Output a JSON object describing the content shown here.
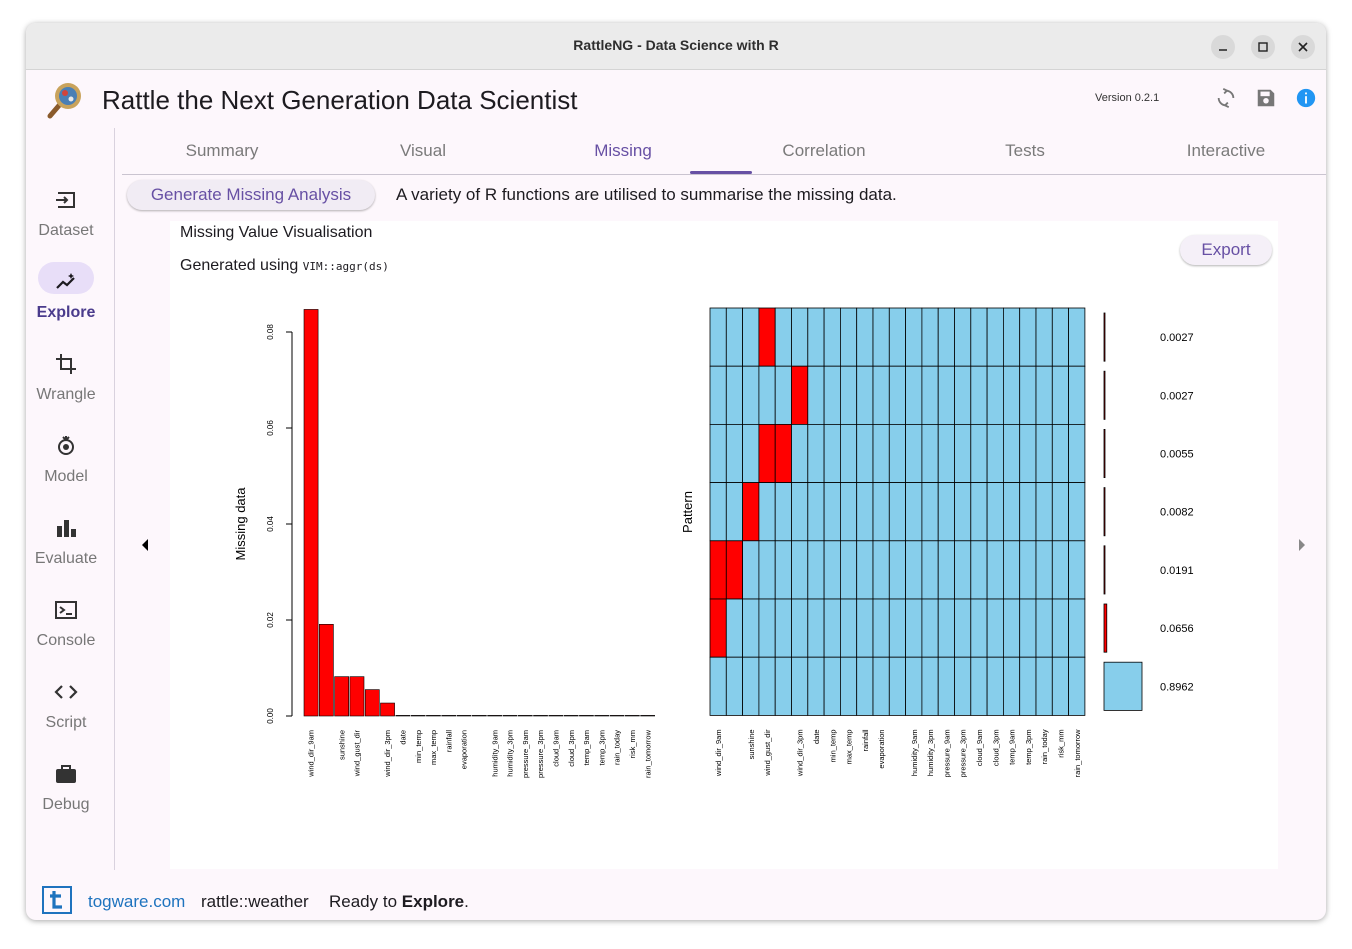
{
  "window": {
    "title": "RattleNG - Data Science with R"
  },
  "app": {
    "title": "Rattle the Next Generation Data Scientist",
    "version": "Version 0.2.1"
  },
  "nav": [
    {
      "label": "Dataset",
      "icon": "dataset-icon"
    },
    {
      "label": "Explore",
      "icon": "explore-icon",
      "active": true
    },
    {
      "label": "Wrangle",
      "icon": "crop-icon"
    },
    {
      "label": "Model",
      "icon": "model-icon"
    },
    {
      "label": "Evaluate",
      "icon": "bar-chart-icon"
    },
    {
      "label": "Console",
      "icon": "terminal-icon"
    },
    {
      "label": "Script",
      "icon": "code-icon"
    },
    {
      "label": "Debug",
      "icon": "briefcase-icon"
    }
  ],
  "tabs": [
    "Summary",
    "Visual",
    "Missing",
    "Correlation",
    "Tests",
    "Interactive"
  ],
  "active_tab": "Missing",
  "missing": {
    "generate_label": "Generate Missing Analysis",
    "description": "A variety of R functions are utilised to summarise the missing data.",
    "panel_title": "Missing Value Visualisation",
    "generated_prefix": "Generated using",
    "generated_code": "VIM::aggr(ds)",
    "export_label": "Export"
  },
  "footer": {
    "link": "togware.com",
    "dataset": "rattle::weather",
    "status_prefix": "Ready to",
    "status_bold": "Explore",
    "status_suffix": "."
  },
  "colors": {
    "missing": "#ff0000",
    "present": "#87ceeb",
    "accent": "#6750a4",
    "link": "#1e73be"
  },
  "chart_data": [
    {
      "type": "bar",
      "ylabel": "Missing data",
      "ylim": [
        0,
        0.085
      ],
      "yticks": [
        "0.00",
        "0.02",
        "0.04",
        "0.06",
        "0.08"
      ],
      "categories": [
        "wind_dir_9am",
        "sunshine",
        "wind_gust_dir",
        "wind_dir_3pm",
        "date",
        "min_temp",
        "max_temp",
        "rainfall",
        "evaporation",
        "humidity_9am",
        "humidity_3pm",
        "pressure_9am",
        "pressure_3pm",
        "cloud_9am",
        "cloud_3pm",
        "temp_9am",
        "temp_3pm",
        "rain_today",
        "risk_mm",
        "rain_tomorrow"
      ],
      "bars": [
        {
          "name": "wind_dir_9am",
          "value": 0.0847
        },
        {
          "name": "",
          "value": 0.0191
        },
        {
          "name": "sunshine",
          "value": 0.0082
        },
        {
          "name": "wind_gust_dir",
          "value": 0.0082
        },
        {
          "name": "",
          "value": 0.0055
        },
        {
          "name": "wind_dir_3pm",
          "value": 0.0027
        },
        {
          "name": "date",
          "value": 0
        },
        {
          "name": "min_temp",
          "value": 0
        },
        {
          "name": "max_temp",
          "value": 0
        },
        {
          "name": "rainfall",
          "value": 0
        },
        {
          "name": "evaporation",
          "value": 0
        },
        {
          "name": "",
          "value": 0
        },
        {
          "name": "humidity_9am",
          "value": 0
        },
        {
          "name": "humidity_3pm",
          "value": 0
        },
        {
          "name": "pressure_9am",
          "value": 0
        },
        {
          "name": "pressure_3pm",
          "value": 0
        },
        {
          "name": "cloud_9am",
          "value": 0
        },
        {
          "name": "cloud_3pm",
          "value": 0
        },
        {
          "name": "temp_9am",
          "value": 0
        },
        {
          "name": "temp_3pm",
          "value": 0
        },
        {
          "name": "rain_today",
          "value": 0
        },
        {
          "name": "risk_mm",
          "value": 0
        },
        {
          "name": "rain_tomorrow",
          "value": 0
        }
      ]
    },
    {
      "type": "heatmap",
      "ylabel": "Pattern",
      "columns": [
        {
          "name": "wind_dir_9am"
        },
        {
          "name": ""
        },
        {
          "name": "sunshine"
        },
        {
          "name": "wind_gust_dir"
        },
        {
          "name": ""
        },
        {
          "name": "wind_dir_3pm"
        },
        {
          "name": "date"
        },
        {
          "name": "min_temp"
        },
        {
          "name": "max_temp"
        },
        {
          "name": "rainfall"
        },
        {
          "name": "evaporation"
        },
        {
          "name": ""
        },
        {
          "name": "humidity_9am"
        },
        {
          "name": "humidity_3pm"
        },
        {
          "name": "pressure_9am"
        },
        {
          "name": "pressure_3pm"
        },
        {
          "name": "cloud_9am"
        },
        {
          "name": "cloud_3pm"
        },
        {
          "name": "temp_9am"
        },
        {
          "name": "temp_3pm"
        },
        {
          "name": "rain_today"
        },
        {
          "name": "risk_mm"
        },
        {
          "name": "rain_tomorrow"
        }
      ],
      "patterns": [
        {
          "missing": [
            3
          ],
          "proportion": 0.0027,
          "label": "0.0027"
        },
        {
          "missing": [
            5
          ],
          "proportion": 0.0027,
          "label": "0.0027"
        },
        {
          "missing": [
            3,
            4
          ],
          "proportion": 0.0055,
          "label": "0.0055"
        },
        {
          "missing": [
            2
          ],
          "proportion": 0.0082,
          "label": "0.0082"
        },
        {
          "missing": [
            0,
            1
          ],
          "proportion": 0.0191,
          "label": "0.0191"
        },
        {
          "missing": [
            0
          ],
          "proportion": 0.0656,
          "label": "0.0656"
        },
        {
          "missing": [],
          "proportion": 0.8962,
          "label": "0.8962"
        }
      ]
    }
  ]
}
